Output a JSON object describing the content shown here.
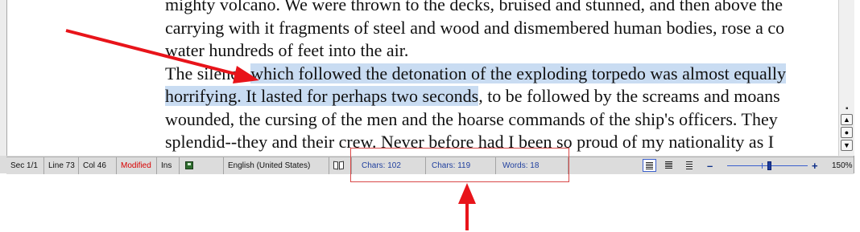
{
  "document": {
    "lines": [
      {
        "before": "mighty volcano. We were thrown to the decks, bruised and stunned, and then above the",
        "selected": "",
        "after": ""
      },
      {
        "before": "carrying with it fragments of steel and wood and dismembered human bodies, rose a co",
        "selected": "",
        "after": ""
      },
      {
        "before": "water hundreds of feet into the air.",
        "selected": "",
        "after": ""
      },
      {
        "before": "The silence ",
        "selected": "which followed the detonation of the exploding torpedo was almost equally",
        "after": ""
      },
      {
        "before": "",
        "selected": "horrifying. It lasted for perhaps two seconds",
        "after": ", to be followed by the screams and moans"
      },
      {
        "before": "wounded, the cursing of the men and the hoarse commands of the ship's officers. They",
        "selected": "",
        "after": ""
      },
      {
        "before": "splendid--they and their crew. Never before had I been so proud of my nationality as I",
        "selected": "",
        "after": ""
      }
    ]
  },
  "statusbar": {
    "section": "Sec 1/1",
    "line": "Line 73",
    "col": "Col 46",
    "modified": "Modified",
    "insert_mode": "Ins",
    "language": "English (United States)",
    "chars_no_spaces": "Chars: 102",
    "chars_with_spaces": "Chars: 119",
    "words": "Words: 18",
    "zoom": "150%",
    "zoom_level_percent": 150
  },
  "colors": {
    "selection": "#c9dcf2",
    "annotation_red": "#e8141a",
    "status_counts": "#1f3f9e",
    "modified": "#d80000"
  },
  "icons": {
    "save": "disk-icon",
    "spellcheck": "book-icon",
    "prev_page": "page-up-icon",
    "browse_object": "browse-object-icon",
    "next_page": "page-down-icon"
  }
}
